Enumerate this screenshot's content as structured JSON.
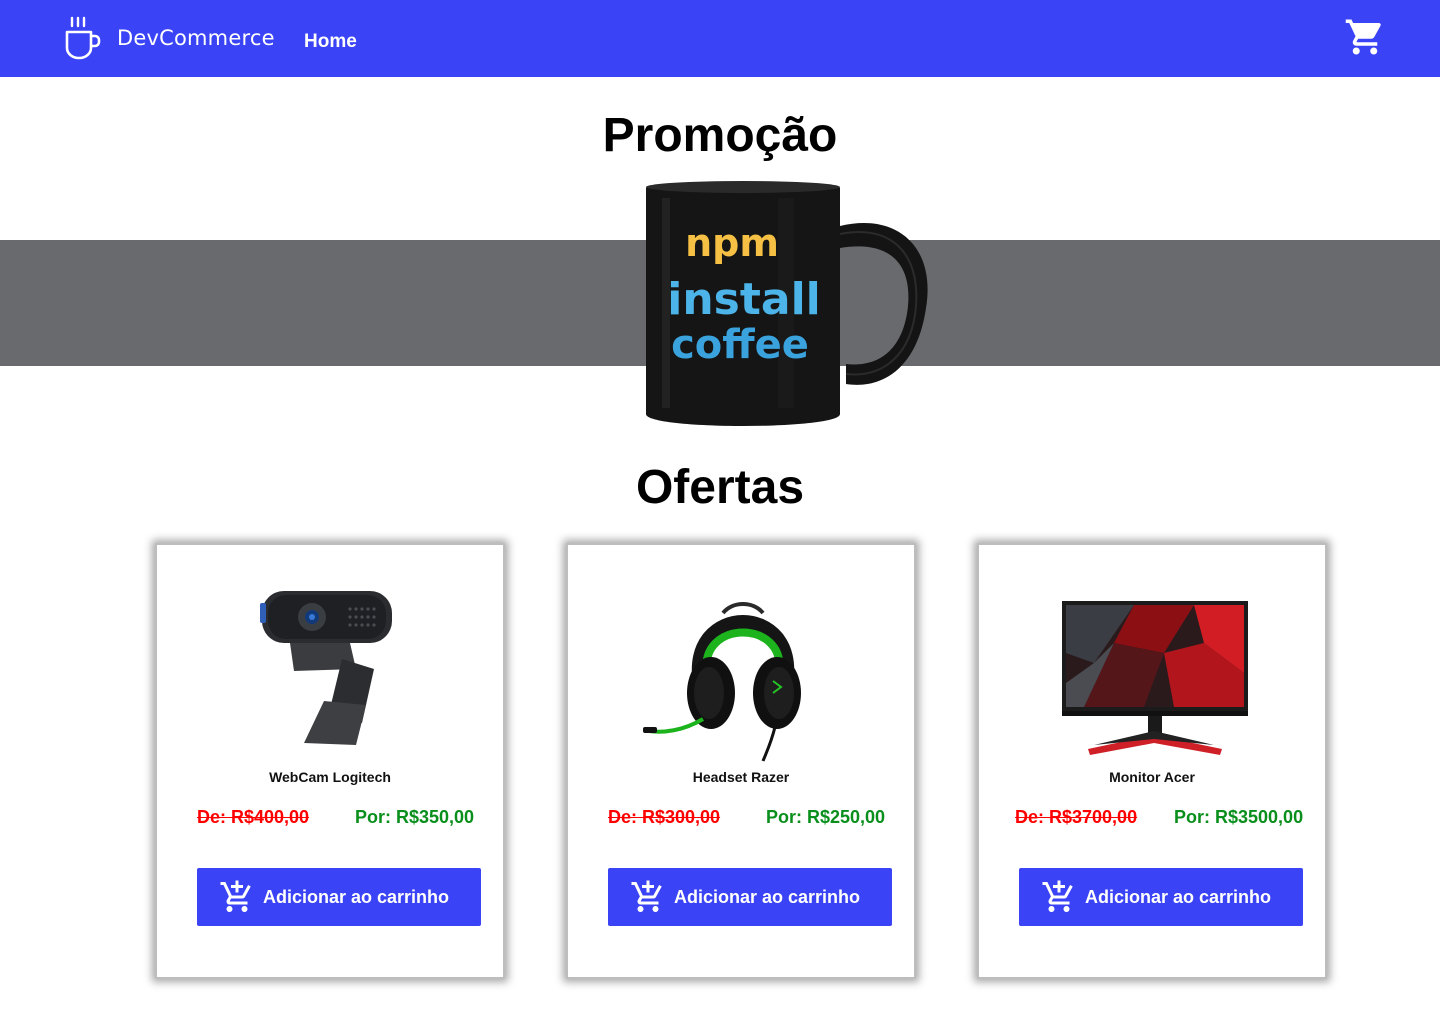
{
  "header": {
    "brand_name": "DevCommerce",
    "nav_home": "Home",
    "brand_color": "#3A43F6"
  },
  "icons": {
    "brand": "coffee-cup-icon",
    "cart": "shopping-cart-icon",
    "add_to_cart": "cart-plus-icon"
  },
  "promo": {
    "title": "Promoção",
    "mug_text": [
      "npm",
      "install",
      "coffee"
    ]
  },
  "offers": {
    "title": "Ofertas",
    "products": [
      {
        "name": "WebCam Logitech",
        "old_price": "De: R$400,00",
        "new_price": "Por: R$350,00",
        "button": "Adicionar ao carrinho"
      },
      {
        "name": "Headset Razer",
        "old_price": "De: R$300,00",
        "new_price": "Por: R$250,00",
        "button": "Adicionar ao carrinho"
      },
      {
        "name": "Monitor Acer",
        "old_price": "De: R$3700,00",
        "new_price": "Por: R$3500,00",
        "button": "Adicionar ao carrinho"
      }
    ]
  },
  "colors": {
    "old_price": "#ff0000",
    "new_price": "#0a8f1d",
    "promo_band": "#686a6d"
  }
}
